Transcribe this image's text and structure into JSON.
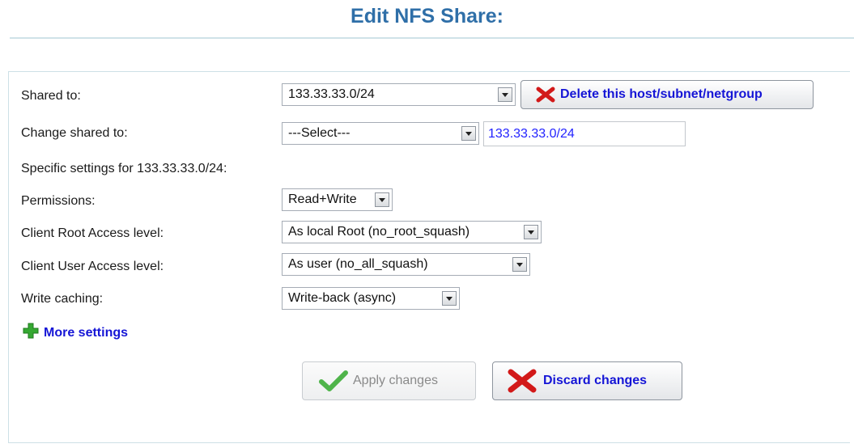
{
  "page": {
    "title": "Edit NFS Share:"
  },
  "form": {
    "shared_to": {
      "label": "Shared to:",
      "value": "133.33.33.0/24"
    },
    "delete_button": {
      "label": "Delete this host/subnet/netgroup"
    },
    "change_shared_to": {
      "label": "Change shared to:",
      "select_value": "---Select---",
      "input_value": "133.33.33.0/24"
    },
    "specific_settings": {
      "label": "Specific settings for 133.33.33.0/24:"
    },
    "permissions": {
      "label": "Permissions:",
      "value": "Read+Write"
    },
    "client_root": {
      "label": "Client Root Access level:",
      "value": "As local Root (no_root_squash)"
    },
    "client_user": {
      "label": "Client User Access level:",
      "value": "As user (no_all_squash)"
    },
    "write_caching": {
      "label": "Write caching:",
      "value": "Write-back (async)"
    },
    "more_settings": {
      "label": "More settings"
    }
  },
  "actions": {
    "apply": {
      "label": "Apply changes",
      "enabled": false
    },
    "discard": {
      "label": "Discard changes",
      "enabled": true
    }
  },
  "colors": {
    "accent": "#1515d6",
    "title": "#2f6fa8",
    "plus": "#35a832",
    "delete_x": "#d21919",
    "check": "#4fb44a"
  },
  "icons": {
    "delete": "red-x-icon",
    "plus": "green-plus-icon",
    "apply": "green-check-icon",
    "discard": "red-x-icon",
    "dropdown": "chevron-down-icon"
  }
}
